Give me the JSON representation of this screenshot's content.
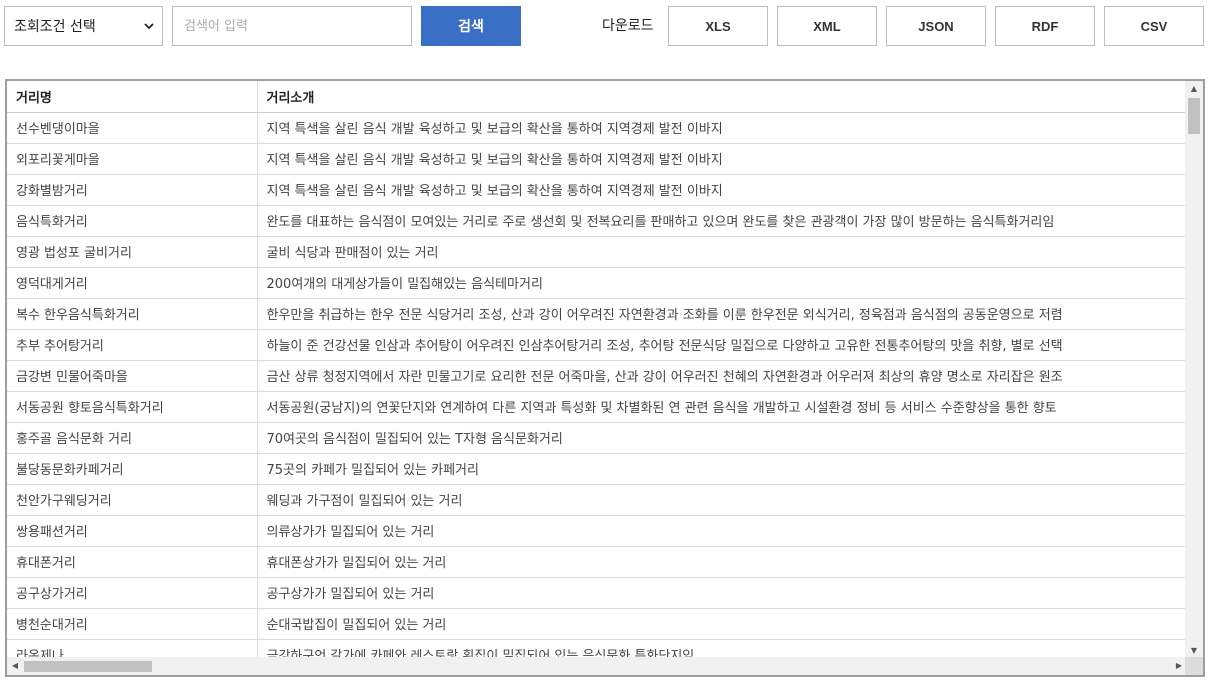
{
  "toolbar": {
    "select_value": "조회조건 선택",
    "search_placeholder": "검색어 입력",
    "search_label": "검색",
    "download_label": "다운로드",
    "formats": [
      "XLS",
      "XML",
      "JSON",
      "RDF",
      "CSV"
    ]
  },
  "table": {
    "headers": [
      "거리명",
      "거리소개"
    ],
    "rows": [
      [
        "선수벤댕이마을",
        "지역 특색을 살린 음식 개발 육성하고 및 보급의 확산을 통하여 지역경제 발전 이바지"
      ],
      [
        "외포리꽃게마을",
        "지역 특색을 살린 음식 개발 육성하고 및 보급의 확산을 통하여 지역경제 발전 이바지"
      ],
      [
        "강화별밤거리",
        "지역 특색을 살린 음식 개발 육성하고 및 보급의 확산을 통하여 지역경제 발전 이바지"
      ],
      [
        "음식특화거리",
        "완도를 대표하는 음식점이 모여있는 거리로 주로 생선회 및 전복요리를 판매하고 있으며 완도를 찾은 관광객이 가장 많이 방문하는 음식특화거리임"
      ],
      [
        "영광 법성포 굴비거리",
        "굴비 식당과 판매점이 있는 거리"
      ],
      [
        "영덕대게거리",
        "200여개의 대게상가들이 밀집해있는 음식테마거리"
      ],
      [
        "복수 한우음식특화거리",
        "한우만을 취급하는 한우 전문 식당거리 조성, 산과 강이 어우려진 자연환경과 조화를 이룬 한우전문 외식거리, 정육점과 음식점의 공동운영으로 저렴"
      ],
      [
        "추부 추어탕거리",
        "하늘이 준 건강선물 인삼과 추어탕이 어우려진 인삼추어탕거리 조성, 추어탕 전문식당 밀집으로 다양하고 고유한 전통추어탕의 맛을 취향, 별로 선택"
      ],
      [
        "금강변 민물어죽마을",
        "금산 상류 청정지역에서 자란 민물고기로 요리한 전문 어죽마을, 산과 강이 어우러진 천혜의 자연환경과 어우러져 최상의 휴양 명소로 자리잡은 원조"
      ],
      [
        "서동공원 향토음식특화거리",
        "서동공원(궁남지)의 연꽃단지와 연계하여 다른 지역과 특성화 및 차별화된 연 관련 음식을 개발하고 시설환경 정비 등 서비스 수준향상을 통한 향토"
      ],
      [
        "홍주골 음식문화 거리",
        "70여곳의 음식점이 밀집되어 있는 T자형 음식문화거리"
      ],
      [
        "불당동문화카페거리",
        "75곳의 카페가 밀집되어 있는 카페거리"
      ],
      [
        "천안가구웨딩거리",
        "웨딩과 가구점이 밀집되어 있는 거리"
      ],
      [
        "쌍용패션거리",
        "의류상가가 밀집되어 있는 거리"
      ],
      [
        "휴대폰거리",
        "휴대폰상가가 밀집되어 있는 거리"
      ],
      [
        "공구상가거리",
        "공구상가가 밀집되어 있는 거리"
      ],
      [
        "병천순대거리",
        "순대국밥집이 밀집되어 있는 거리"
      ],
      [
        "라온제나",
        "금강하구언 갈가에 카페와 레스토랑 횟집이 밀집되어 있는 음식문화 특화단지임"
      ]
    ]
  },
  "icons": {
    "select_chevron": "chevron-down-icon",
    "scroll_up": "arrow-up-icon",
    "scroll_down": "arrow-down-icon",
    "scroll_left": "arrow-left-icon",
    "scroll_right": "arrow-right-icon"
  },
  "colors": {
    "accent": "#3a6fc6"
  }
}
